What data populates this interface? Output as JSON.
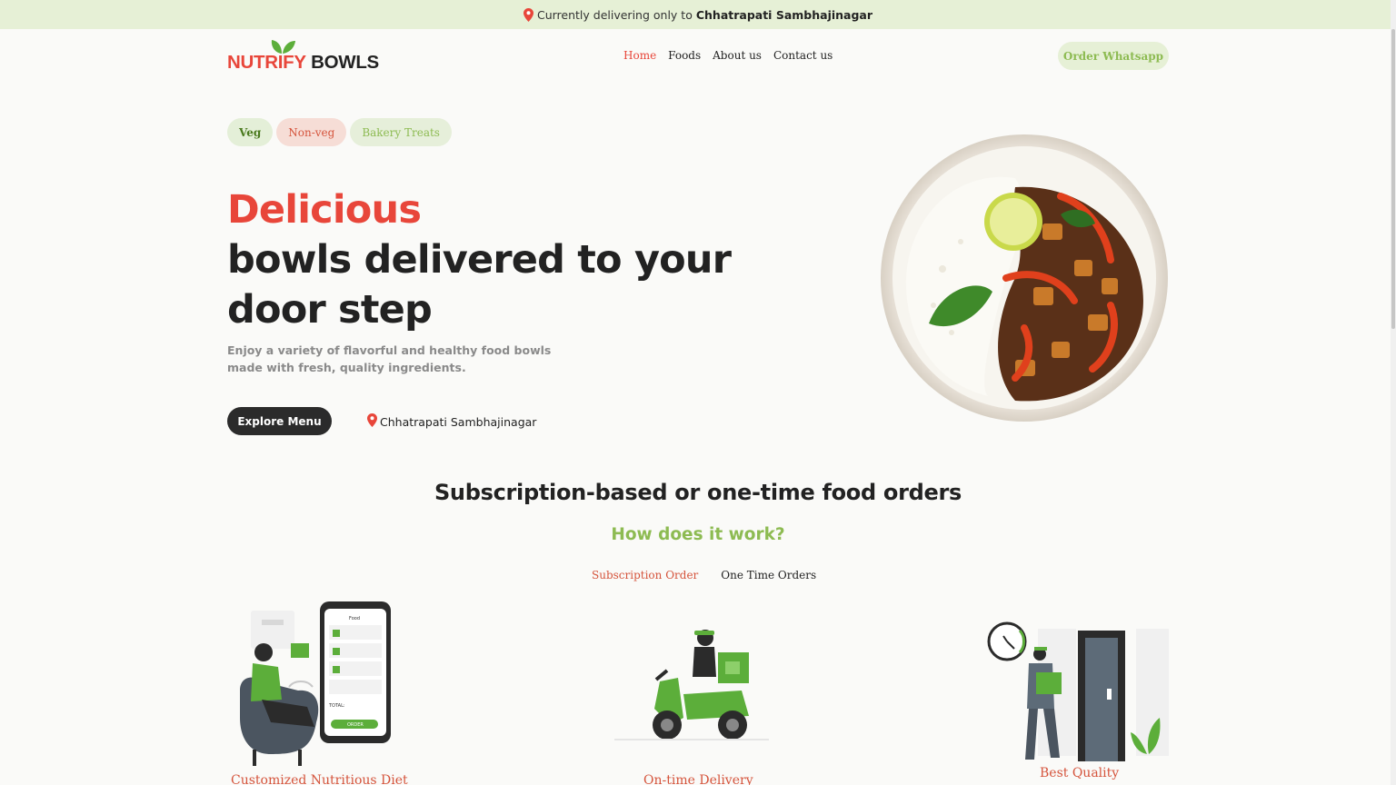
{
  "announcement": {
    "prefix": "Currently delivering only to",
    "city": "Chhatrapati Sambhajinagar"
  },
  "logo": {
    "part1": "NUTRIFY",
    "part2": "BOWLS"
  },
  "nav": [
    {
      "label": "Home",
      "active": true
    },
    {
      "label": "Foods",
      "active": false
    },
    {
      "label": "About us",
      "active": false
    },
    {
      "label": "Contact us",
      "active": false
    }
  ],
  "order_button": "Order Whatsapp",
  "chips": [
    "Veg",
    "Non-veg",
    "Bakery Treats"
  ],
  "hero": {
    "title_highlight": "Delicious",
    "title_rest": "bowls delivered to your door step",
    "subtitle": "Enjoy a variety of flavorful and healthy food bowls made with fresh, quality ingredients.",
    "explore_button": "Explore Menu",
    "location": "Chhatrapati Sambhajinagar"
  },
  "how": {
    "heading": "Subscription-based or one-time food orders",
    "subheading": "How does it work?",
    "tabs": [
      "Subscription Order",
      "One Time Orders"
    ],
    "steps": [
      {
        "caption": "Customized Nutritious Diet"
      },
      {
        "caption": "On-time Delivery"
      },
      {
        "caption": "Best Quality"
      }
    ],
    "phone_labels": {
      "header": "Food",
      "total": "TOTAL:",
      "order": "ORDER"
    }
  },
  "colors": {
    "accent_red": "#e8463a",
    "accent_green": "#8dbb52",
    "topbar_bg": "#e6f0d6",
    "dark": "#2b2b2b"
  }
}
